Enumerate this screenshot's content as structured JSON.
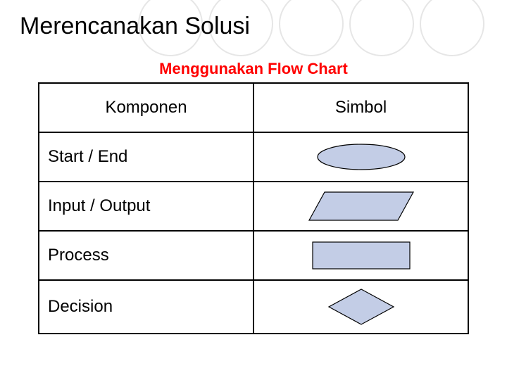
{
  "title": "Merencanakan Solusi",
  "subtitle": "Menggunakan Flow Chart",
  "header": {
    "komponen": "Komponen",
    "simbol": "Simbol"
  },
  "rows": [
    {
      "label": "Start / End",
      "shape": "terminator"
    },
    {
      "label": "Input / Output",
      "shape": "parallelogram"
    },
    {
      "label": "Process",
      "shape": "rectangle"
    },
    {
      "label": "Decision",
      "shape": "diamond"
    }
  ],
  "colors": {
    "shape_fill": "#c3cde6",
    "subtitle": "#ff0000"
  }
}
